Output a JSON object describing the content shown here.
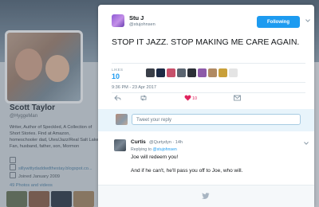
{
  "background_profile": {
    "name": "Scott Taylor",
    "handle": "@HyggeMan",
    "bio": "Writer, Author of Speckled, A Collection of Short Stories. Find at Amazon, homeschooler dad, Utes/Jazz/Real Salt Lake Fan, husband, father, son, Mormon",
    "link": "sillywittydaddwdthestay.blogspot.co...",
    "joined": "Joined January 2009",
    "photos": "49 Photos and videos"
  },
  "tweet": {
    "author_name": "Stu J",
    "author_handle": "@stujohnsen",
    "follow_label": "Following",
    "text": "STOP IT JAZZ. STOP MAKING ME CARE AGAIN.",
    "likes_label": "LIKES",
    "likes_count": "10",
    "timestamp": "9:36 PM - 23 Apr 2017",
    "like_action_count": "10"
  },
  "reply_box": {
    "placeholder": "Tweet your reply"
  },
  "reply": {
    "author_name": "Curtis",
    "author_meta": "@Qurtydyn · 14h",
    "replying_prefix": "Replying to",
    "replying_handle": "@stujohnsen",
    "text1": "Joe will redeem you!",
    "text2": "And if he can't, he'll pass you off to Joe, who will."
  },
  "colors": {
    "accent": "#1d9bf0",
    "like": "#e0245e"
  }
}
